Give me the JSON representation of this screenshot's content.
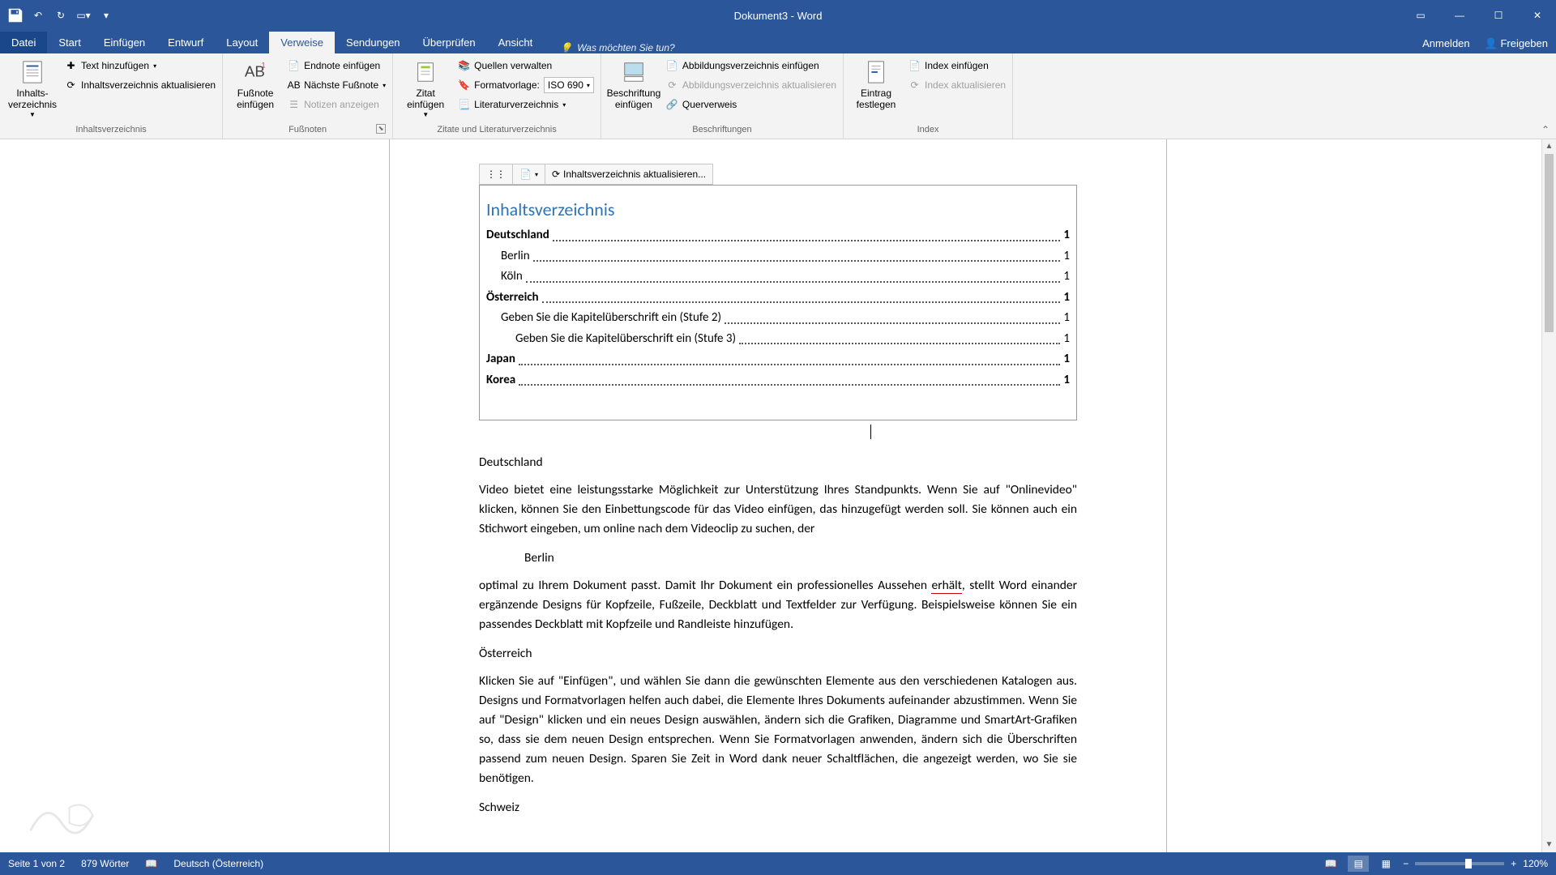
{
  "window": {
    "title": "Dokument3 - Word"
  },
  "tabs": {
    "file": "Datei",
    "list": [
      "Start",
      "Einfügen",
      "Entwurf",
      "Layout",
      "Verweise",
      "Sendungen",
      "Überprüfen",
      "Ansicht"
    ],
    "active_index": 4,
    "tell_me": "Was möchten Sie tun?",
    "sign_in": "Anmelden",
    "share": "Freigeben"
  },
  "ribbon": {
    "toc": {
      "big": "Inhalts-\nverzeichnis",
      "add_text": "Text hinzufügen",
      "update": "Inhaltsverzeichnis aktualisieren",
      "group": "Inhaltsverzeichnis"
    },
    "footnotes": {
      "big": "Fußnote\neinfügen",
      "endnote": "Endnote einfügen",
      "next": "Nächste Fußnote",
      "show": "Notizen anzeigen",
      "group": "Fußnoten"
    },
    "citations": {
      "big": "Zitat\neinfügen",
      "sources": "Quellen verwalten",
      "style_label": "Formatvorlage:",
      "style_value": "ISO 690",
      "biblio": "Literaturverzeichnis",
      "group": "Zitate und Literaturverzeichnis"
    },
    "captions": {
      "big": "Beschriftung\neinfügen",
      "insert_fig": "Abbildungsverzeichnis einfügen",
      "update_fig": "Abbildungsverzeichnis aktualisieren",
      "crossref": "Querverweis",
      "group": "Beschriftungen"
    },
    "index": {
      "big": "Eintrag\nfestlegen",
      "insert": "Index einfügen",
      "update": "Index aktualisieren",
      "group": "Index"
    }
  },
  "toc_control": {
    "update_label": "Inhaltsverzeichnis aktualisieren...",
    "title": "Inhaltsverzeichnis",
    "rows": [
      {
        "text": "Deutschland",
        "page": "1",
        "level": 0,
        "bold": true
      },
      {
        "text": "Berlin",
        "page": "1",
        "level": 1,
        "bold": false
      },
      {
        "text": "Köln",
        "page": "1",
        "level": 1,
        "bold": false
      },
      {
        "text": "Österreich",
        "page": "1",
        "level": 0,
        "bold": true
      },
      {
        "text": "Geben Sie die Kapitelüberschrift ein (Stufe 2)",
        "page": "1",
        "level": 1,
        "bold": false
      },
      {
        "text": "Geben Sie die Kapitelüberschrift ein (Stufe 3)",
        "page": "1",
        "level": 2,
        "bold": false
      },
      {
        "text": "Japan",
        "page": "1",
        "level": 0,
        "bold": true
      },
      {
        "text": "Korea",
        "page": "1",
        "level": 0,
        "bold": true
      }
    ]
  },
  "body": {
    "h1": "Deutschland",
    "p1": "Video bietet eine leistungsstarke Möglichkeit zur Unterstützung Ihres Standpunkts. Wenn Sie auf \"Onlinevideo\" klicken, können Sie den Einbettungscode für das Video einfügen, das hinzugefügt werden soll. Sie können auch ein Stichwort eingeben, um online nach dem Videoclip zu suchen, der",
    "h1a": "Berlin",
    "p2a": "optimal zu Ihrem Dokument passt. Damit Ihr Dokument ein professionelles Aussehen ",
    "p2_err": "erhält",
    "p2b": ", stellt Word einander ergänzende Designs für Kopfzeile, Fußzeile, Deckblatt und Textfelder zur Verfügung. Beispielsweise können Sie ein passendes Deckblatt mit Kopfzeile und Randleiste hinzufügen.",
    "h2": "Österreich",
    "p3": "Klicken Sie auf \"Einfügen\", und wählen Sie dann die gewünschten Elemente aus den verschiedenen Katalogen aus. Designs und Formatvorlagen helfen auch dabei, die Elemente Ihres Dokuments aufeinander abzustimmen. Wenn Sie auf \"Design\" klicken und ein neues Design auswählen, ändern sich die Grafiken, Diagramme und SmartArt-Grafiken so, dass sie dem neuen Design entsprechen. Wenn Sie Formatvorlagen anwenden, ändern sich die Überschriften passend zum neuen Design. Sparen Sie Zeit in Word dank neuer Schaltflächen, die angezeigt werden, wo Sie sie benötigen.",
    "h3": "Schweiz"
  },
  "status": {
    "page": "Seite 1 von 2",
    "words": "879 Wörter",
    "lang": "Deutsch (Österreich)",
    "zoom": "120%"
  }
}
